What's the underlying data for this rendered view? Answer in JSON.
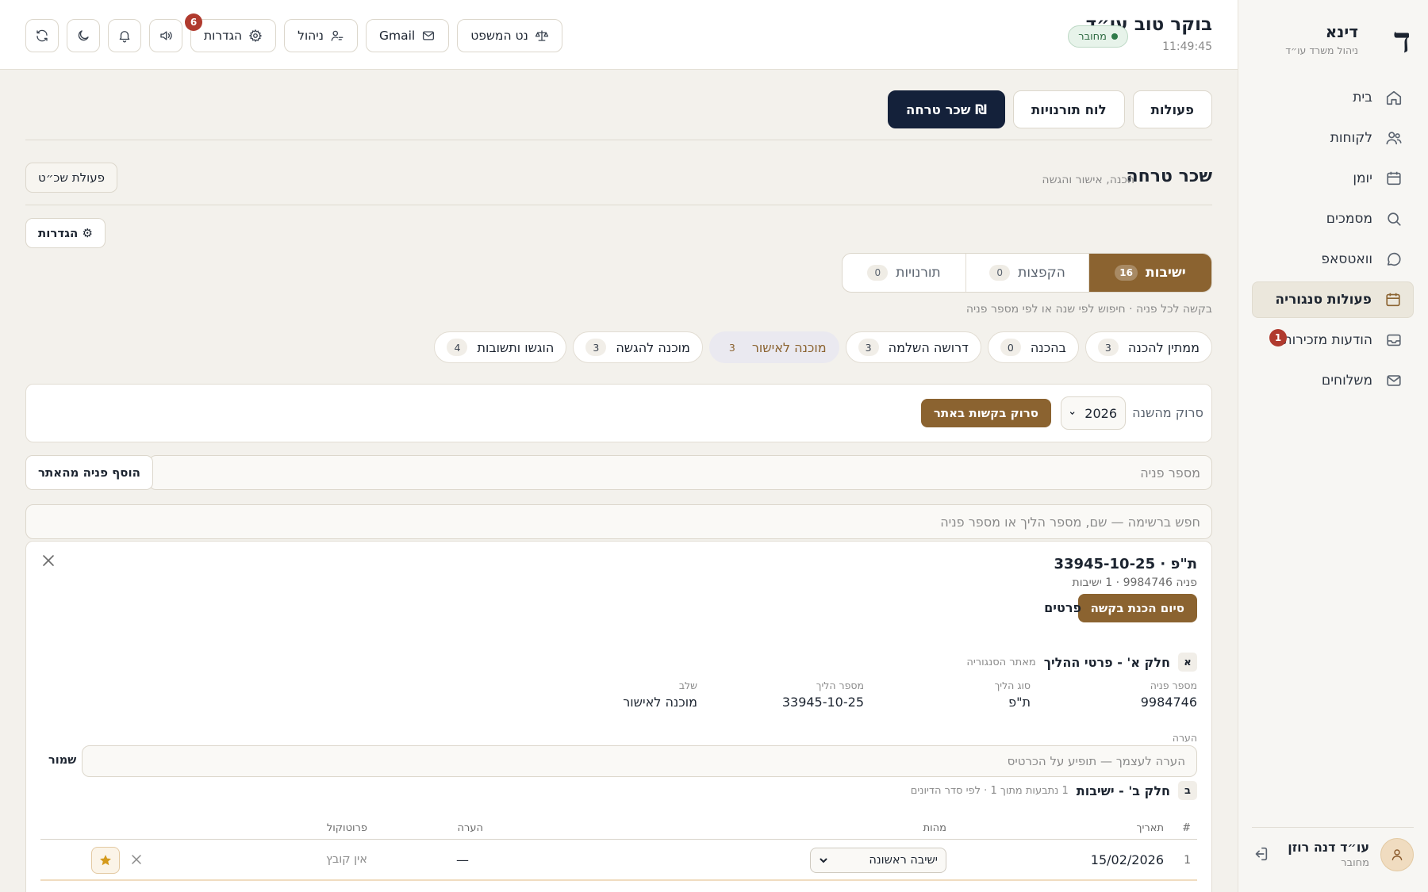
{
  "sidebar": {
    "brand_letter": "ד",
    "brand_name": "דינא",
    "brand_sub": "ניהול משרד עו״ד",
    "items": [
      {
        "label": "בית",
        "icon": "home-icon"
      },
      {
        "label": "לקוחות",
        "icon": "users-icon"
      },
      {
        "label": "יומן",
        "icon": "calendar-icon"
      },
      {
        "label": "מסמכים",
        "icon": "search-icon"
      },
      {
        "label": "וואטסאפ",
        "icon": "chat-icon"
      },
      {
        "label": "פעולות סנגוריה",
        "icon": "calendar-icon",
        "active": true
      },
      {
        "label": "הודעות מזכירות",
        "icon": "inbox-icon",
        "badge": "1"
      },
      {
        "label": "משלוחים",
        "icon": "mail-icon"
      }
    ],
    "user": {
      "name": "עו״ד דנה רוזן",
      "status": "מחובר"
    }
  },
  "topbar": {
    "greeting": "בוקר טוב עו״ד",
    "time": "11:49:45",
    "connection": "מחובר",
    "buttons": {
      "net_hamishpat": "נט המשפט",
      "gmail": "Gmail",
      "admin": "ניהול",
      "settings": "הגדרות",
      "settings_badge": "6"
    }
  },
  "tabs": {
    "actions": "פעולות",
    "rotations_board": "לוח תורנויות",
    "fee": "₪ שכר טרחה"
  },
  "section": {
    "title": "שכר טרחה",
    "subtitle": "הכנה, אישור והגשה",
    "fee_action_btn": "פעולת שכ״ט",
    "settings_btn": "⚙ הגדרות"
  },
  "segments": [
    {
      "label": "ישיבות",
      "count": "16",
      "active": true
    },
    {
      "label": "הקפצות",
      "count": "0"
    },
    {
      "label": "תורנויות",
      "count": "0"
    }
  ],
  "segment_hint": "בקשה לכל פניה · חיפוש לפי שנה או לפי מספר פניה",
  "status_chips": [
    {
      "label": "ממתין להכנה",
      "count": "3"
    },
    {
      "label": "בהכנה",
      "count": "0"
    },
    {
      "label": "דרושה השלמה",
      "count": "3"
    },
    {
      "label": "מוכנה לאישור",
      "count": "3",
      "active": true
    },
    {
      "label": "מוכנה להגשה",
      "count": "3"
    },
    {
      "label": "הוגשו ותשובות",
      "count": "4"
    }
  ],
  "scan": {
    "label": "סרוק מהשנה",
    "year": "2026",
    "button": "סרוק בקשות באתר"
  },
  "case_input": {
    "placeholder": "מספר פניה",
    "add_button": "הוסף פניה מהאתר"
  },
  "list_search": {
    "placeholder": "חפש ברשימה — שם, מספר הליך או מספר פניה"
  },
  "case": {
    "title": "ת\"פ · 33945-10-25",
    "meta": "פניה 9984746 · 1 ישיבות",
    "finish_btn": "סיום הכנת בקשה",
    "details_link": "פרטים",
    "part_a": {
      "letter": "א",
      "title": "חלק א' - פרטי ההליך",
      "sub": "מאתר הסנגוריה",
      "fields": [
        {
          "label": "מספר פניה",
          "value": "9984746"
        },
        {
          "label": "סוג הליך",
          "value": "ת\"פ"
        },
        {
          "label": "מספר הליך",
          "value": "33945-10-25"
        },
        {
          "label": "שלב",
          "value": "מוכנה לאישור"
        }
      ],
      "note_label": "הערה",
      "note_placeholder": "הערה לעצמך — תופיע על הכרטיס",
      "save": "שמור"
    },
    "part_b": {
      "letter": "ב",
      "title": "חלק ב' - ישיבות",
      "sub": "1 נתבעות מתוך 1 · לפי סדר הדיונים",
      "columns": {
        "num": "#",
        "date": "תאריך",
        "nature": "מהות",
        "note": "הערה",
        "protocol": "פרוטוקול"
      },
      "rows": [
        {
          "num": "1",
          "date": "15/02/2026",
          "nature": "ישיבה ראשונה",
          "note": "—",
          "protocol": "אין קובץ"
        }
      ]
    }
  }
}
